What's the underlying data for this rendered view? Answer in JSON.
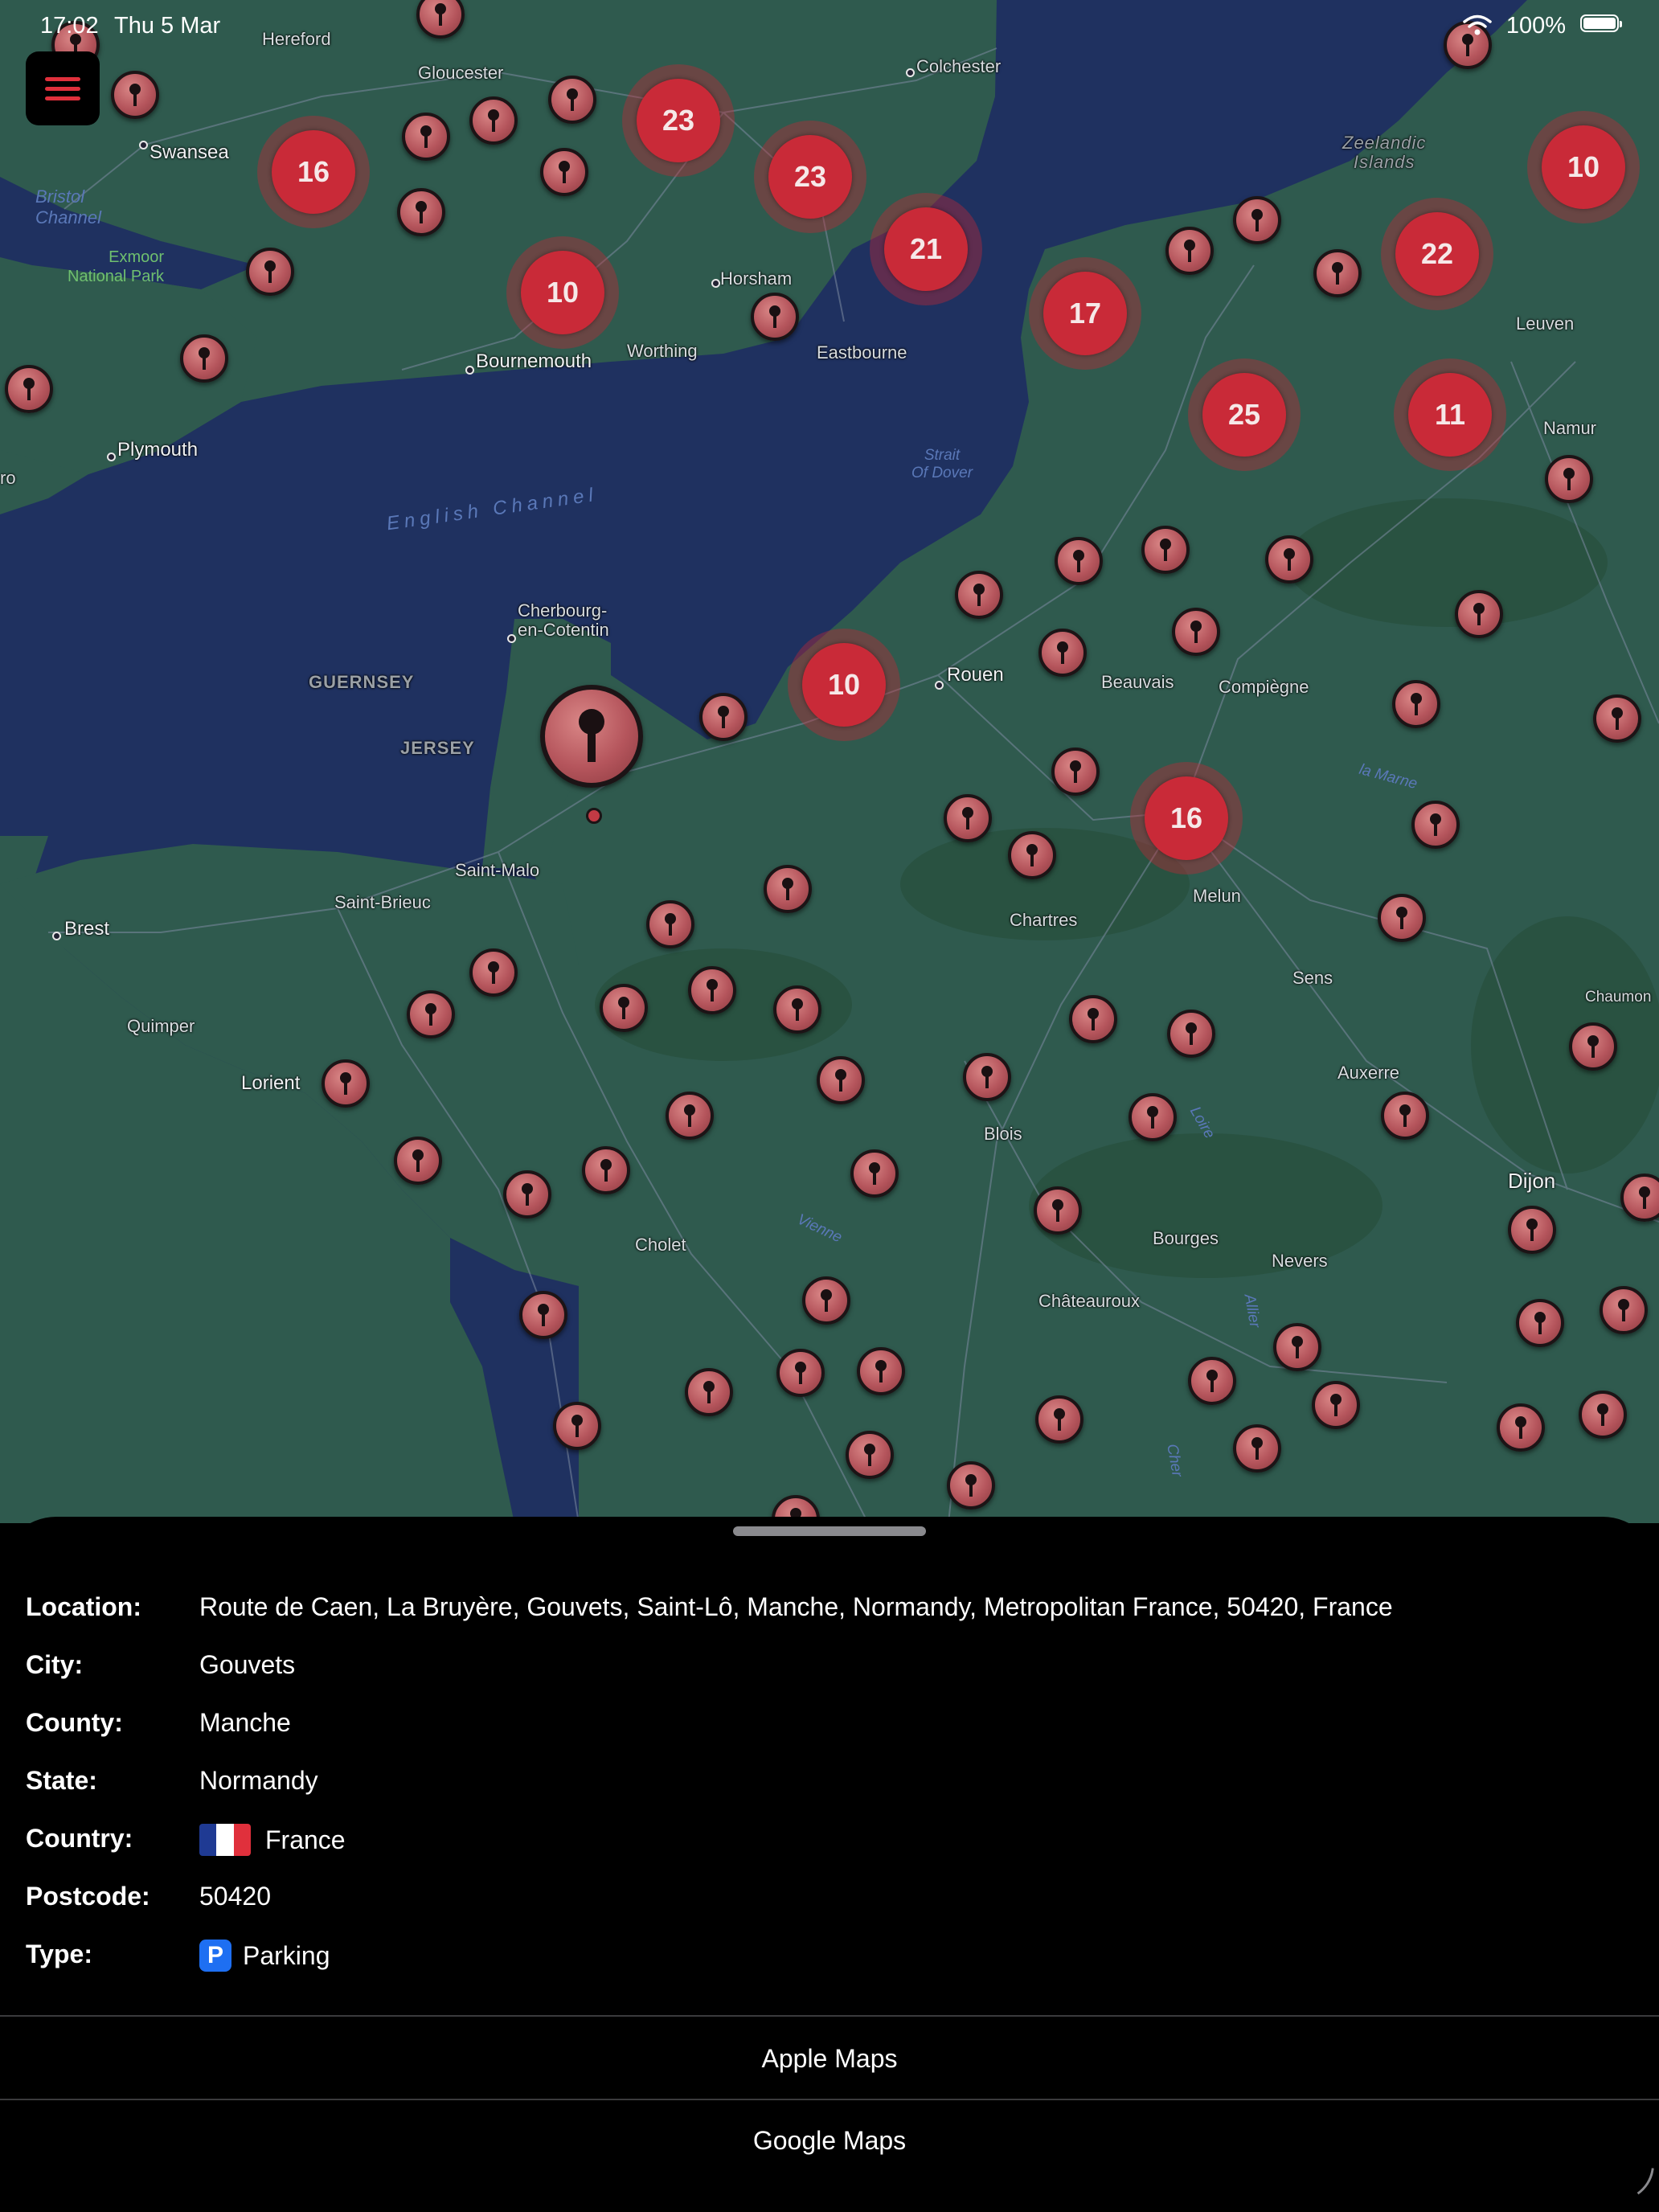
{
  "status_bar": {
    "time": "17:02",
    "date": "Thu 5 Mar",
    "battery_percent": "100%"
  },
  "map": {
    "labels": {
      "hereford": "Hereford",
      "gloucester": "Gloucester",
      "colchester": "Colchester",
      "swansea": "Swansea",
      "bristol_channel": "Bristol\nChannel",
      "exmoor": "Exmoor\nNational Park",
      "horsham": "Horsham",
      "worthing": "Worthing",
      "eastbourne": "Eastbourne",
      "bournemouth": "Bournemouth",
      "plymouth": "Plymouth",
      "ro": "ro",
      "zeelandic": "Zeelandic\nIslands",
      "leuven": "Leuven",
      "namur": "Namur",
      "strait": "Strait\nOf Dover",
      "english_channel": "English Channel",
      "cherbourg": "Cherbourg-\nen-Cotentin",
      "guernsey": "GUERNSEY",
      "jersey": "JERSEY",
      "rouen": "Rouen",
      "beauvais": "Beauvais",
      "compiegne": "Compiègne",
      "la_marne": "la Marne",
      "saint_malo": "Saint-Malo",
      "saint_brieuc": "Saint-Brieuc",
      "brest": "Brest",
      "melun": "Melun",
      "chartres": "Chartres",
      "sens": "Sens",
      "chaumont": "Chaumon",
      "quimper": "Quimper",
      "lorient": "Lorient",
      "auxerre": "Auxerre",
      "loire": "Loire",
      "blois": "Blois",
      "dijon": "Dijon",
      "cholet": "Cholet",
      "vienne": "Vienne",
      "bourges": "Bourges",
      "nevers": "Nevers",
      "chateauroux": "Châteauroux",
      "allier": "Allier",
      "cher": "Cher"
    },
    "clusters": [
      "16",
      "23",
      "23",
      "21",
      "10",
      "17",
      "22",
      "10",
      "25",
      "11",
      "10",
      "16"
    ]
  },
  "details": {
    "location_label": "Location:",
    "location_value": "Route de Caen, La Bruyère, Gouvets, Saint-Lô, Manche, Normandy, Metropolitan France, 50420, France",
    "city_label": "City:",
    "city_value": "Gouvets",
    "county_label": "County:",
    "county_value": "Manche",
    "state_label": "State:",
    "state_value": "Normandy",
    "country_label": "Country:",
    "country_value": "France",
    "postcode_label": "Postcode:",
    "postcode_value": "50420",
    "type_label": "Type:",
    "type_badge": "P",
    "type_value": "Parking"
  },
  "actions": {
    "apple_maps": "Apple Maps",
    "google_maps": "Google Maps"
  },
  "colors": {
    "accent_red": "#c92a38",
    "sea": "#1f3160",
    "land": "#2f5a4e",
    "sheet_bg": "#000000"
  },
  "icons": [
    "menu-icon",
    "wifi-icon",
    "battery-icon",
    "location-pin-icon",
    "france-flag-icon",
    "parking-icon"
  ]
}
